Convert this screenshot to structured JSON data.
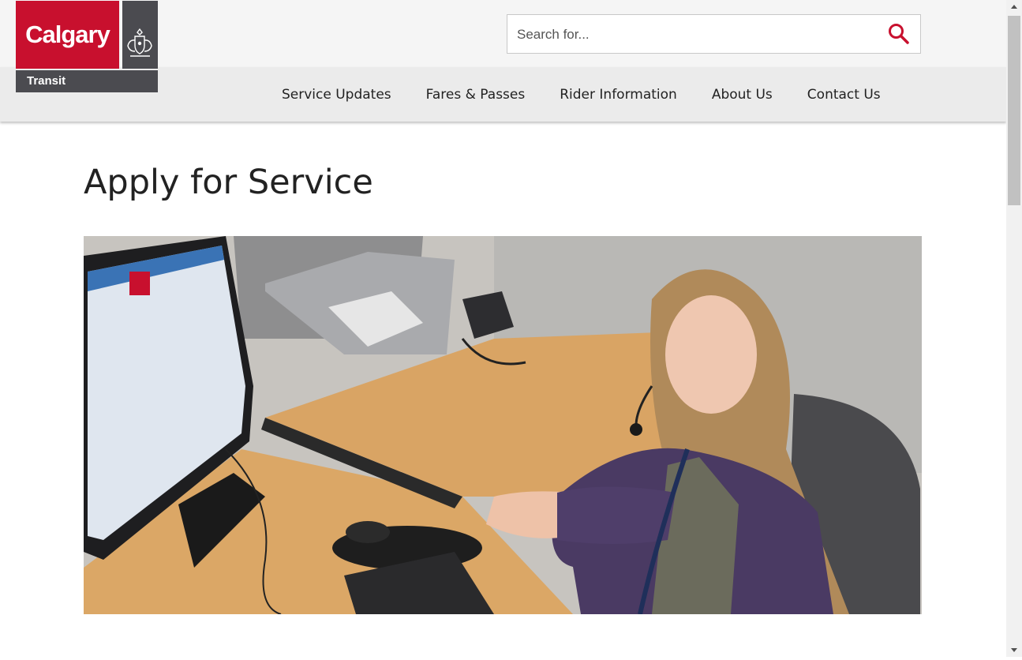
{
  "brand": {
    "name": "Calgary",
    "subtitle": "Transit",
    "primary_color": "#c8102e",
    "secondary_color": "#4b4b50"
  },
  "search": {
    "placeholder": "Search for...",
    "value": "",
    "icon": "magnifier-icon",
    "icon_color": "#c8102e"
  },
  "nav": {
    "items": [
      {
        "label": "Service Updates"
      },
      {
        "label": "Fares & Passes"
      },
      {
        "label": "Rider Information"
      },
      {
        "label": "About Us"
      },
      {
        "label": "Contact Us"
      }
    ]
  },
  "main": {
    "title": "Apply for Service"
  }
}
